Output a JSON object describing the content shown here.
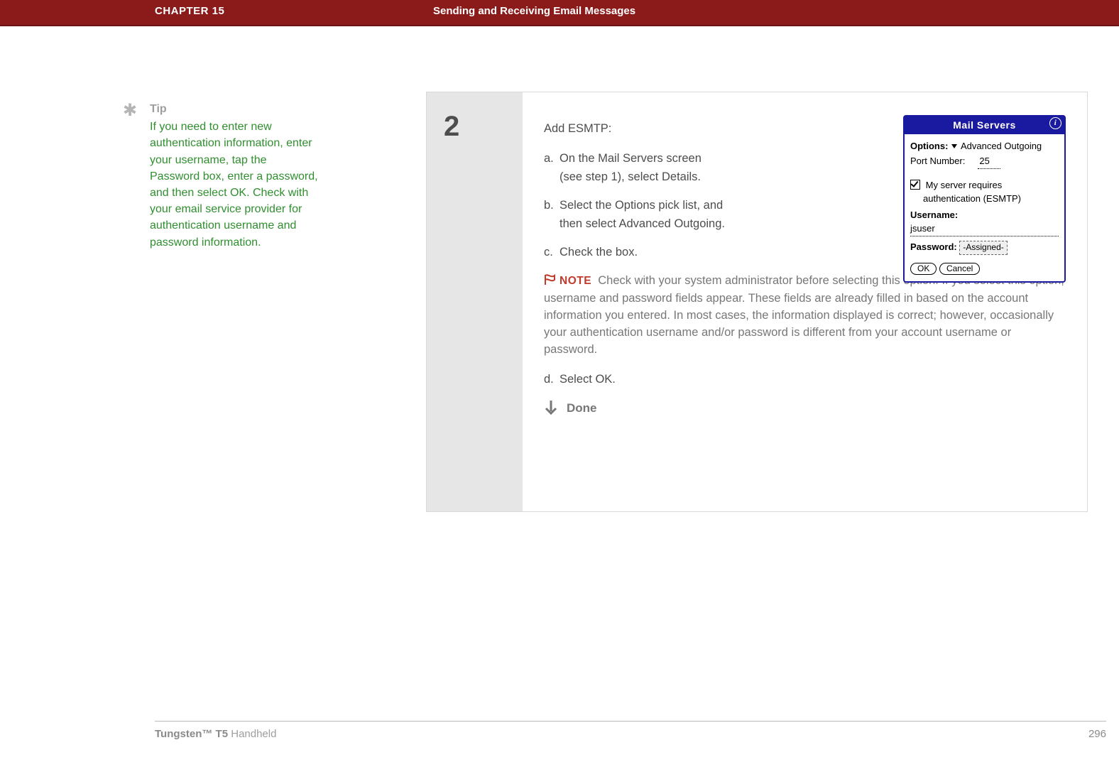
{
  "header": {
    "chapter": "CHAPTER 15",
    "title": "Sending and Receiving Email Messages"
  },
  "tip": {
    "label": "Tip",
    "body": "If you need to enter new authentication information, enter your username, tap the Password box, enter a password, and then select OK. Check with your email service provider for authentication username and password information."
  },
  "step": {
    "number": "2",
    "title": "Add ESMTP:",
    "items": {
      "a_letter": "a.",
      "a_line1": "On the Mail Servers screen",
      "a_line2": "(see step 1), select Details.",
      "b_letter": "b.",
      "b_line1": "Select the Options pick list, and",
      "b_line2": "then select Advanced Outgoing.",
      "c_letter": "c.",
      "c_text": "Check the box.",
      "d_letter": "d.",
      "d_text": "Select OK."
    },
    "note_label": "NOTE",
    "note_text": "Check with your system administrator before selecting this option. If you select this option, username and password fields appear. These fields are already filled in based on the account information you entered. In most cases, the information displayed is correct; however, occasionally your authentication username and/or password is different from your account username or password.",
    "done": "Done"
  },
  "device": {
    "title": "Mail Servers",
    "options_label": "Options:",
    "options_value": "Advanced Outgoing",
    "port_label": "Port Number:",
    "port_value": "25",
    "esmtp_line1": "My server requires",
    "esmtp_line2": "authentication (ESMTP)",
    "username_label": "Username:",
    "username_value": "jsuser",
    "password_label": "Password:",
    "password_value": "-Assigned-",
    "ok": "OK",
    "cancel": "Cancel"
  },
  "footer": {
    "product_bold": "Tungsten™ T5",
    "product_rest": " Handheld",
    "page": "296"
  }
}
